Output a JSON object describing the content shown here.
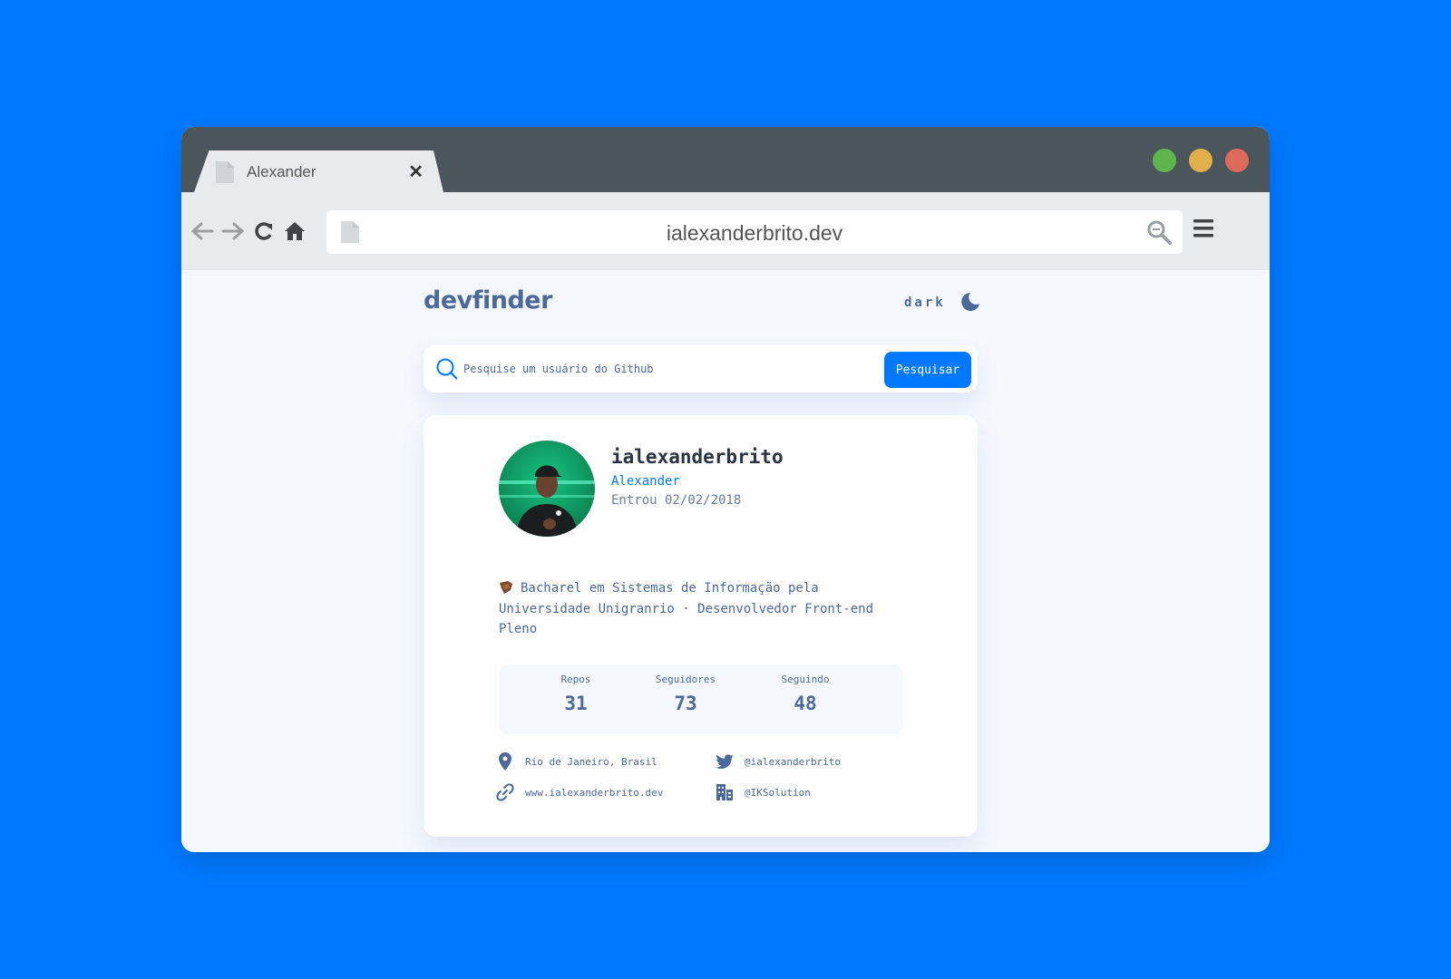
{
  "browser": {
    "tab_title": "Alexander",
    "tab_close": "✕",
    "url": "ialexanderbrito.dev",
    "colors": {
      "titlebar": "#4B565C",
      "toolbar": "#E8EAED",
      "dot_green": "#5FB44C",
      "dot_yellow": "#E3AE4C",
      "dot_red": "#DD6B5C"
    }
  },
  "app": {
    "logo": "devfinder",
    "theme_toggle_label": "dark",
    "theme_icon": "moon-icon",
    "accent": "#0079FF"
  },
  "search": {
    "placeholder": "Pesquise um usuário do Github",
    "value": "",
    "button_label": "Pesquisar"
  },
  "profile": {
    "username": "ialexanderbrito",
    "name": "Alexander",
    "joined": "Entrou 02/02/2018",
    "bio": "Bacharel em Sistemas de Informação pela Universidade Unigranrio · Desenvolvedor Front-end Pleno",
    "stats": [
      {
        "label": "Repos",
        "value": "31"
      },
      {
        "label": "Seguidores",
        "value": "73"
      },
      {
        "label": "Seguindo",
        "value": "48"
      }
    ],
    "links": {
      "location": "Rio de Janeiro, Brasil",
      "twitter": "@ialexanderbrito",
      "website": "www.ialexanderbrito.dev",
      "company": "@IKSolution"
    }
  }
}
